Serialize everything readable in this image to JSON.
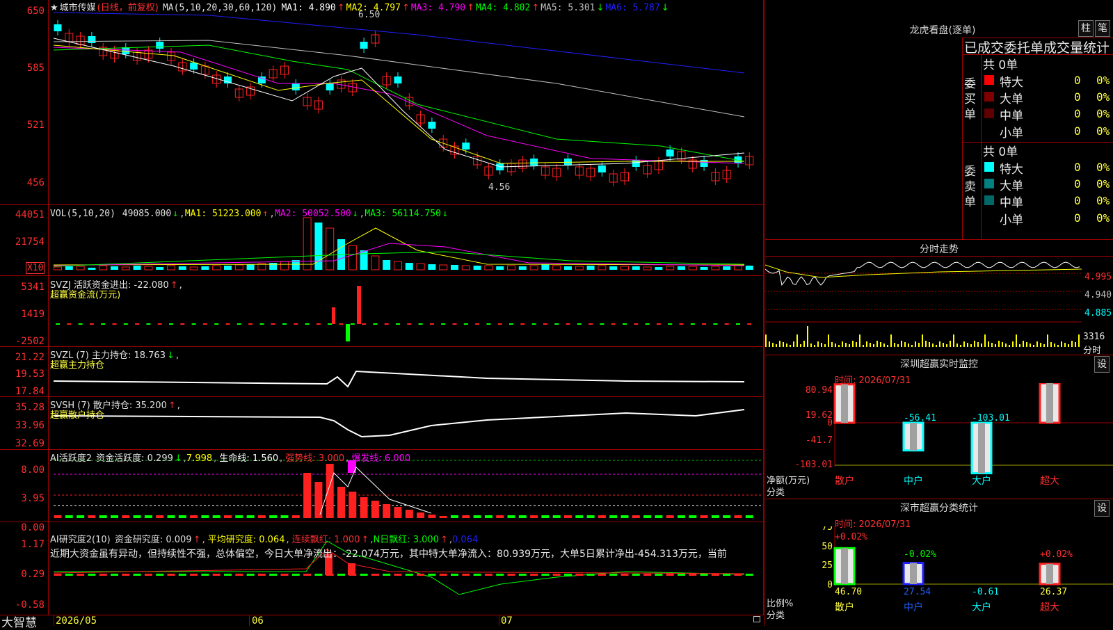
{
  "colors": {
    "up": "#ff2020",
    "down": "#00ffff",
    "bg": "#000000",
    "grid": "#a00000",
    "yellow": "#ffff40",
    "ma1": "#ffffff",
    "ma2": "#ffff00",
    "ma3": "#ff00ff",
    "ma4": "#00ff00",
    "ma5": "#c0c0c0",
    "ma6": "#2020ff"
  },
  "main": {
    "title_star": "★",
    "stock_name": "城市传媒",
    "period_note": "(日线，前复权)",
    "ma_label": "MA(5,10,20,30,60,120)",
    "ma1": "MA1: 4.890",
    "ma2": "MA2: 4.797",
    "ma3": "MA3: 4.790",
    "ma4": "MA4: 4.802",
    "ma5": "MA5: 5.301",
    "ma6": "MA6: 5.787",
    "arrow_up": "↑",
    "arrow_down": "↓",
    "y_ticks": [
      "650",
      "585",
      "521",
      "456"
    ],
    "high_note": "6.50",
    "low_note": "4.56"
  },
  "vol": {
    "label": "VOL(5,10,20)",
    "value": "49085.000",
    "ma1": "MA1: 51223.000",
    "ma2": "MA2: 50052.500",
    "ma3": "MA3: 56114.750",
    "y_ticks": [
      "44051",
      "21754"
    ],
    "unit": "X10"
  },
  "svzj": {
    "label": "SVZJ  活跃资金进出: -22.080",
    "sub": "超赢资金流(万元)",
    "y_ticks": [
      "5341",
      "1419",
      "-2502"
    ]
  },
  "svzl": {
    "label": "SVZL  (7)  主力持仓: 18.763",
    "sub": "超赢主力持仓",
    "y_ticks": [
      "21.22",
      "19.53",
      "17.84"
    ]
  },
  "svsh": {
    "label": "SVSH  (7)  散户持仓: 35.200",
    "sub": "超赢散户持仓",
    "y_ticks": [
      "35.28",
      "33.96",
      "32.69"
    ]
  },
  "ai_active": {
    "label": "AI活跃度2",
    "v1": "资金活跃度: 0.299",
    "v2": "7.998",
    "v3": "生命线: 1.560",
    "v4": "强势线: 3.000",
    "v5": "爆发线: 6.000",
    "y_ticks": [
      "8.00",
      "3.95",
      "0.00"
    ]
  },
  "ai_research": {
    "label": "AI研究度2(10)",
    "v1": "资金研究度: 0.009",
    "v2": "平均研究度: 0.064",
    "v3": "连续飘红: 1.000",
    "v4": "N日飘红: 3.000",
    "v5": "0.064",
    "comment": "近期大资金虽有异动，但持续性不强，总体偏空，今日大单净流出：-22.074万元，其中特大单净流入：80.939万元，大单5日累计净出-454.313万元，当前",
    "y_ticks": [
      "1.17",
      "0.29",
      "-0.58"
    ]
  },
  "xaxis": {
    "brand": "大智慧",
    "labels": [
      "2026/05",
      "06",
      "07"
    ]
  },
  "dragon": {
    "title": "龙虎看盘(逐单)",
    "btn1": "柱",
    "btn2": "笔",
    "subtitle": "已成交委托单成交量统计",
    "buy_label": "委买单",
    "sell_label": "委卖单",
    "buy_total": "共 0单",
    "sell_total": "共 0单",
    "rows": [
      "特大",
      "大单",
      "中单",
      "小单"
    ],
    "counts": [
      "0",
      "0",
      "0",
      "0"
    ],
    "pcts": [
      "0%",
      "0%",
      "0%",
      "0%"
    ]
  },
  "tick": {
    "title": "分时走势",
    "prices": [
      "4.995",
      "4.940",
      "4.885"
    ],
    "vol": "3316",
    "vol_label": "分时"
  },
  "monitor": {
    "title": "深圳超赢实时监控",
    "btn": "设",
    "time": "时间: 2026/07/31",
    "y_ticks": [
      "80.94",
      "19.62",
      "0",
      "-41.7",
      "-103.01"
    ],
    "values": [
      "78.49",
      "-56.41",
      "-103.01",
      "80.94"
    ],
    "categories": [
      "散户",
      "中户",
      "大户",
      "超大"
    ],
    "ylabel": "净额(万元)",
    "xlabel": "分类"
  },
  "classify": {
    "title": "深市超赢分类统计",
    "btn": "设",
    "time": "时间: 2026/07/31",
    "y_ticks": [
      "75",
      "50",
      "25",
      "0"
    ],
    "top_values": [
      "+0.02%",
      "-0.02%",
      "+0.02%"
    ],
    "bottom_values": [
      "46.70",
      "27.54",
      "-0.61",
      "26.37"
    ],
    "categories": [
      "散户",
      "中户",
      "大户",
      "超大"
    ],
    "ylabel": "比例%",
    "xlabel": "分类"
  }
}
